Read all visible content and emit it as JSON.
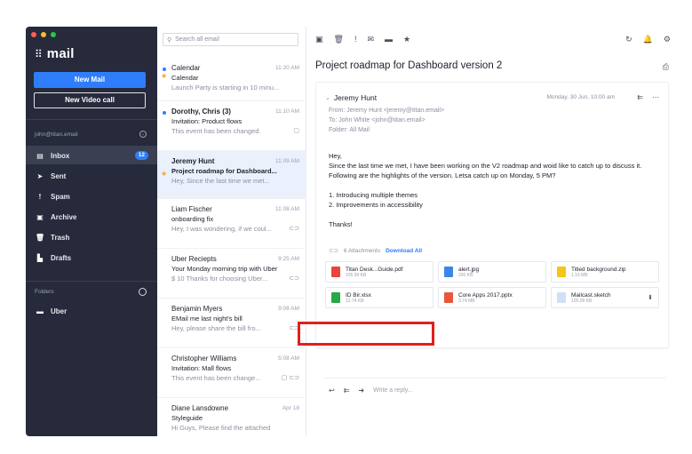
{
  "app": {
    "name": "mail",
    "grid_icon": "grid-icon"
  },
  "window_dots": [
    "#ff5f56",
    "#ffbd2e",
    "#27c93f"
  ],
  "sidebar": {
    "new_mail": "New Mail",
    "new_video_call": "New Video call",
    "account": "john@titan.email",
    "nav": [
      {
        "label": "Inbox",
        "icon": "inbox-icon",
        "glyph": "▤",
        "badge": "12",
        "active": true
      },
      {
        "label": "Sent",
        "icon": "send-icon",
        "glyph": "➤"
      },
      {
        "label": "Spam",
        "icon": "spam-icon",
        "glyph": "!"
      },
      {
        "label": "Archive",
        "icon": "archive-icon",
        "glyph": "▣"
      },
      {
        "label": "Trash",
        "icon": "trash-icon",
        "glyph": "🗑"
      },
      {
        "label": "Drafts",
        "icon": "drafts-icon",
        "glyph": "▙"
      }
    ],
    "folders_label": "Folders",
    "folders": [
      {
        "label": "Uber",
        "icon": "folder-icon",
        "glyph": "▬"
      }
    ]
  },
  "search": {
    "placeholder": "Search all email"
  },
  "messages": [
    {
      "from": "Calendar",
      "time": "11:20 AM",
      "subject": "Calendar",
      "preview": "Launch Party is starting in 10 minu...",
      "mark": "dot-star"
    },
    {
      "from": "Dorothy, Chris (3)",
      "time": "11:10 AM",
      "subject": "Invitation: Product flows",
      "preview": "This event has been changed.",
      "mark": "dot",
      "bold": true,
      "icons": "▢"
    },
    {
      "from": "Jeremy Hunt",
      "time": "11:09 AM",
      "subject": "Project roadmap for Dashboard...",
      "preview": "Hey, Since the last time we met...",
      "mark": "star",
      "bold": true,
      "selected": true
    },
    {
      "from": "Liam Fischer",
      "time": "11:08 AM",
      "subject": "onboarding fix",
      "preview": "Hey, I was wondering, if we coul...",
      "icons": "⊂⊃"
    },
    {
      "from": "Uber Reciepts",
      "time": "9:25 AM",
      "subject": "Your Monday morning trip with Uber",
      "preview": "$ 10 Thanks for choosing Uber...",
      "icons": "⊂⊃"
    },
    {
      "from": "Benjamin Myers",
      "time": "9:08 AM",
      "subject": "EMail me last night's bill",
      "preview": "Hey, please share the bill fro...",
      "icons": "⊂⊃"
    },
    {
      "from": "Christopher Williams",
      "time": "5:08 AM",
      "subject": "Invitation: Mall flows",
      "preview": "This event has been change...",
      "icons": "▢ ⊂⊃"
    },
    {
      "from": "Diane Lansdowne",
      "time": "Apr 18",
      "subject": "Styleguide",
      "preview": "Hi Guys, Please find the attached"
    }
  ],
  "toolbar": {
    "left": [
      "▣",
      "🗑",
      "!",
      "✉",
      "▬",
      "★"
    ],
    "left_names": [
      "archive-icon",
      "trash-icon",
      "spam-icon",
      "mark-unread-icon",
      "move-folder-icon",
      "star-icon"
    ],
    "right": [
      "↻",
      "🔔",
      "⚙"
    ],
    "right_names": [
      "refresh-icon",
      "bell-icon",
      "settings-icon"
    ]
  },
  "email": {
    "subject": "Project roadmap for Dashboard version 2",
    "sender": "Jeremy Hunt",
    "date": "Monday, 30 Jun, 10:00 am",
    "from_line": "From: Jeremy Hunt <jeremy@titan.email>",
    "to_line": "To: John White <john@titan.email>",
    "folder_line": "Folder: All Mail",
    "body": [
      "Hey,",
      "Since the last time we met, I have been working on the V2 roadmap and woid like to catch up to discuss it. Following are the highlights of the version. Letsa catch up on Monday, 5 PM?",
      "1. Introducing multiple themes\n2. Improvements in accessibility",
      "Thanks!"
    ],
    "attachments_label": "6 Attachments",
    "download_all": "Download All",
    "attachments": [
      {
        "name": "Titan Desk...Guide.pdf",
        "size": "105.99 KB",
        "color": "#e8453c"
      },
      {
        "name": "alert.jpg",
        "size": "200 KB",
        "color": "#3c86e8"
      },
      {
        "name": "Titled background.zip",
        "size": "1.16 MB",
        "color": "#f5c518"
      },
      {
        "name": "ID Bir.xlsx",
        "size": "12.74 KB",
        "color": "#27a84a"
      },
      {
        "name": "Core Apps 2017.pptx",
        "size": "3.74 MB",
        "color": "#e8573c"
      },
      {
        "name": "Mailcast.sketch",
        "size": "105.99 KB",
        "color": "#cfe0f5"
      }
    ],
    "reply_placeholder": "Write a reply..."
  }
}
